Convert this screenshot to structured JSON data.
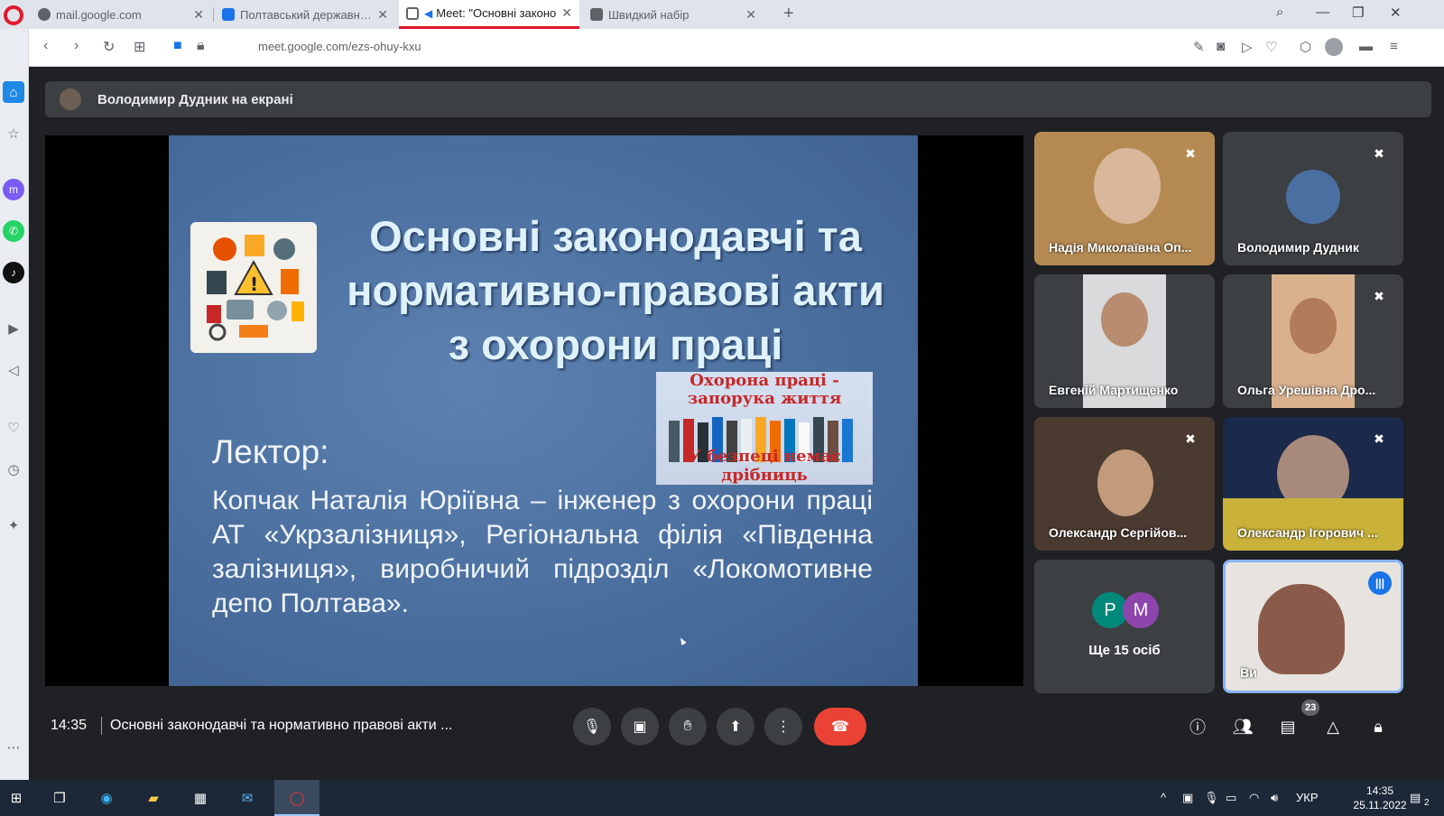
{
  "browser": {
    "tabs": [
      {
        "label": "mail.google.com",
        "favicon": "globe-icon",
        "active": false
      },
      {
        "label": "Полтавський державний а",
        "favicon": "calendar-icon",
        "active": false
      },
      {
        "label": "Meet: \"Основні законо",
        "favicon": "meet-icon",
        "active": true
      },
      {
        "label": "Швидкий набір",
        "favicon": "grid-icon",
        "active": false
      }
    ],
    "url": "meet.google.com/ezs-ohuy-kxu",
    "colors": {
      "accent": "#e0182d",
      "tabbar": "#dfe3ea"
    }
  },
  "meet": {
    "presenter_label": "Володимир Дудник на екрані",
    "slide": {
      "title": "Основні законодавчі та нормативно-правові акти з охорони праці",
      "poster_top": "Охорона праці - запорука життя",
      "poster_bottom": "У безпеці немає дрібниць",
      "lector_label": "Лектор:",
      "lector_text": "Копчак Наталія Юріївна – інженер з охорони праці АТ «Укрзалізниця», Регіональна філія «Південна залізниця», виробничий підрозділ «Локомотивне депо Полтава»."
    },
    "participants": [
      {
        "name": "Надія Миколаївна Оп...",
        "muted": true
      },
      {
        "name": "Володимир Дудник",
        "muted": true
      },
      {
        "name": "Евгеній Мартищенко",
        "muted": false
      },
      {
        "name": "Ольга Урешівна Дро...",
        "muted": true
      },
      {
        "name": "Олександр Сергійов...",
        "muted": true
      },
      {
        "name": "Олександр Ігорович ...",
        "muted": true
      }
    ],
    "more": {
      "initials": [
        "P",
        "M"
      ],
      "label": "Ще 15 осіб"
    },
    "self": {
      "name": "Ви",
      "speaking": true
    },
    "bottom": {
      "time": "14:35",
      "title": "Основні законодавчі та нормативно правові акти ...",
      "participants_count": "23"
    }
  },
  "taskbar": {
    "language": "УКР",
    "time": "14:35",
    "date": "25.11.2022",
    "notifications": "2"
  }
}
